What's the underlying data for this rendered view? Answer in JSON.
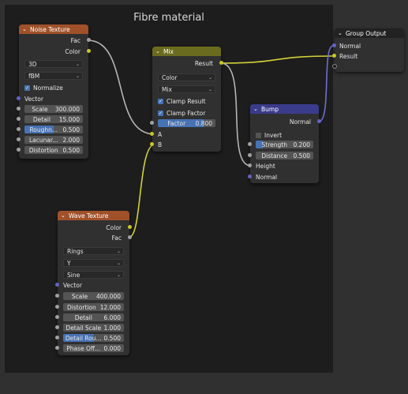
{
  "frame": {
    "title": "Fibre material"
  },
  "noise": {
    "title": "Noise Texture",
    "out_fac": "Fac",
    "out_color": "Color",
    "dim": "3D",
    "type": "fBM",
    "normalize": "Normalize",
    "in_vector": "Vector",
    "scale_label": "Scale",
    "scale_value": "300.000",
    "detail_label": "Detail",
    "detail_value": "15.000",
    "rough_label": "Roughn...",
    "rough_value": "0.500",
    "lacun_label": "Lacunar...",
    "lacun_value": "2.000",
    "distort_label": "Distortion",
    "distort_value": "0.500"
  },
  "mix": {
    "title": "Mix",
    "out_result": "Result",
    "data_type": "Color",
    "blend": "Mix",
    "clamp_result": "Clamp Result",
    "clamp_factor": "Clamp Factor",
    "factor_label": "Factor",
    "factor_value": "0.800",
    "in_a": "A",
    "in_b": "B"
  },
  "group_output": {
    "title": "Group Output",
    "in_normal": "Normal",
    "in_result": "Result"
  },
  "bump": {
    "title": "Bump",
    "out_normal": "Normal",
    "invert": "Invert",
    "strength_label": "Strength",
    "strength_value": "0.200",
    "distance_label": "Distance",
    "distance_value": "0.500",
    "in_height": "Height",
    "in_normal": "Normal"
  },
  "wave": {
    "title": "Wave Texture",
    "out_color": "Color",
    "out_fac": "Fac",
    "wave_type": "Rings",
    "direction": "Y",
    "profile": "Sine",
    "in_vector": "Vector",
    "scale_label": "Scale",
    "scale_value": "400.000",
    "distort_label": "Distortion",
    "distort_value": "12.000",
    "detail_label": "Detail",
    "detail_value": "6.000",
    "dscale_label": "Detail Scale",
    "dscale_value": "1.000",
    "drough_label": "Detail Rou...",
    "drough_value": "0.500",
    "phase_label": "Phase Off...",
    "phase_value": "0.000"
  },
  "colors": {
    "texture_header": "#a0512a",
    "converter_header": "#6b6b1f",
    "vector_header": "#3b3b8c",
    "socket_color": "#c7c729",
    "socket_float": "#a1a1a1",
    "socket_vector": "#6363c7"
  }
}
